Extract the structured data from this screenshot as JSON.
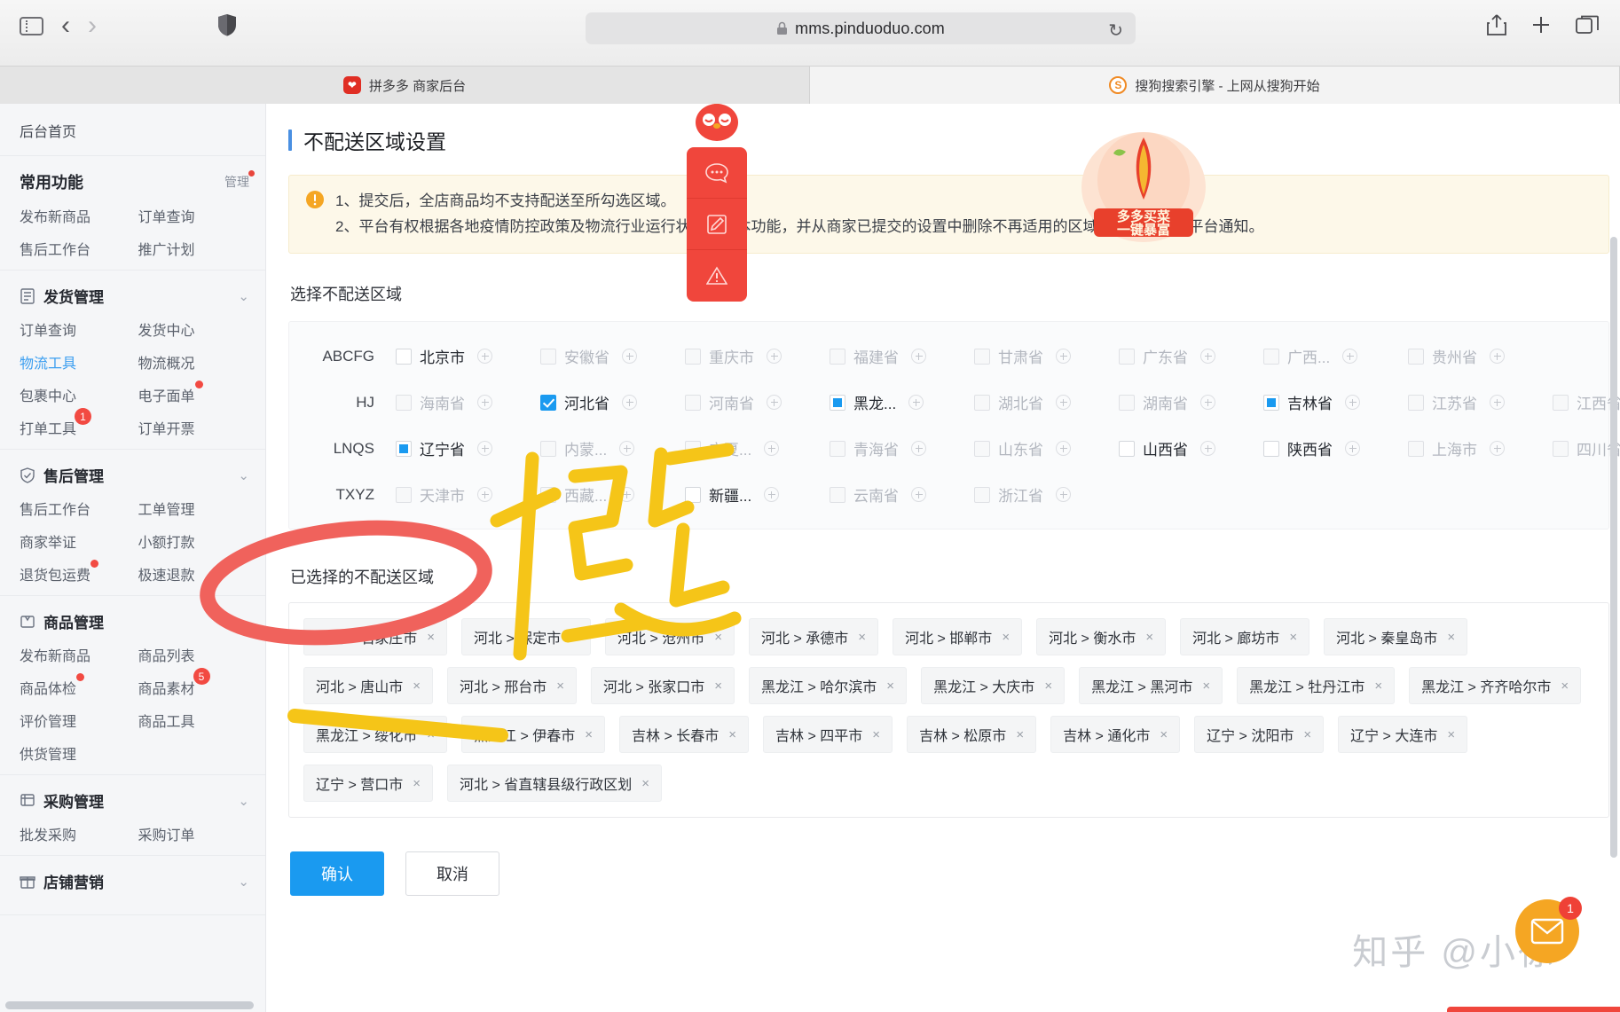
{
  "browser": {
    "url": "mms.pinduoduo.com",
    "lock_icon": "lock-icon",
    "reload_icon": "reload-icon",
    "sidebar_toggle_icon": "sidebar-toggle-icon",
    "back_icon": "back-arrow-icon",
    "forward_icon": "forward-arrow-icon",
    "shield_icon": "privacy-shield-icon",
    "share_icon": "share-icon",
    "newtab_icon": "new-tab-icon",
    "tabs_overview_icon": "tab-overview-icon",
    "tabs": [
      {
        "title": "拼多多 商家后台",
        "favicon": "pinduoduo-favicon",
        "active": false
      },
      {
        "title": "搜狗搜索引擎 - 上网从搜狗开始",
        "favicon": "sogou-favicon",
        "active": true
      }
    ]
  },
  "sidebar": {
    "home": "后台首页",
    "sections": [
      {
        "title": "常用功能",
        "manage_label": "管理",
        "manage_dot": true,
        "icon": null,
        "collapsible": false,
        "links": [
          {
            "label": "发布新商品"
          },
          {
            "label": "订单查询"
          },
          {
            "label": "售后工作台"
          },
          {
            "label": "推广计划"
          }
        ]
      },
      {
        "title": "发货管理",
        "icon": "document-icon",
        "collapsible": true,
        "links": [
          {
            "label": "订单查询"
          },
          {
            "label": "发货中心"
          },
          {
            "label": "物流工具",
            "active": true
          },
          {
            "label": "物流概况"
          },
          {
            "label": "包裹中心"
          },
          {
            "label": "电子面单",
            "badge_dot": true
          },
          {
            "label": "打单工具",
            "badge": "1"
          },
          {
            "label": "订单开票"
          }
        ]
      },
      {
        "title": "售后管理",
        "icon": "shield-check-icon",
        "collapsible": true,
        "links": [
          {
            "label": "售后工作台"
          },
          {
            "label": "工单管理"
          },
          {
            "label": "商家举证"
          },
          {
            "label": "小额打款"
          },
          {
            "label": "退货包运费",
            "badge_dot": true
          },
          {
            "label": "极速退款"
          }
        ]
      },
      {
        "title": "商品管理",
        "icon": "tag-icon",
        "collapsible": true,
        "links": [
          {
            "label": "发布新商品"
          },
          {
            "label": "商品列表"
          },
          {
            "label": "商品体检",
            "badge_dot": true
          },
          {
            "label": "商品素材",
            "badge": "5"
          },
          {
            "label": "评价管理"
          },
          {
            "label": "商品工具"
          },
          {
            "label": "供货管理"
          }
        ]
      },
      {
        "title": "采购管理",
        "icon": "cart-icon",
        "collapsible": true,
        "links": [
          {
            "label": "批发采购"
          },
          {
            "label": "采购订单"
          }
        ]
      },
      {
        "title": "店铺营销",
        "icon": "gift-icon",
        "collapsible": true,
        "links": []
      }
    ]
  },
  "main": {
    "page_title": "不配送区域设置",
    "notice": {
      "icon": "warning-icon",
      "line1": "1、提交后，全店商品均不支持配送至所勾选区域。",
      "line2": "2、平台有权根据各地疫情防控政策及物流行业运行状况更新本功能，并从商家已提交的设置中删除不再适用的区域，请商家关注平台通知。"
    },
    "select_label": "选择不配送区域",
    "province_rows": [
      {
        "group": "ABCFG",
        "items": [
          {
            "name": "北京市",
            "state": "unchecked",
            "highlight": true
          },
          {
            "name": "安徽省",
            "state": "unchecked"
          },
          {
            "name": "重庆市",
            "state": "unchecked"
          },
          {
            "name": "福建省",
            "state": "unchecked"
          },
          {
            "name": "甘肃省",
            "state": "unchecked"
          },
          {
            "name": "广东省",
            "state": "unchecked"
          },
          {
            "name": "广西...",
            "state": "unchecked"
          },
          {
            "name": "贵州省",
            "state": "unchecked"
          }
        ]
      },
      {
        "group": "HJ",
        "items": [
          {
            "name": "海南省",
            "state": "unchecked"
          },
          {
            "name": "河北省",
            "state": "checked",
            "highlight": true
          },
          {
            "name": "河南省",
            "state": "unchecked"
          },
          {
            "name": "黑龙...",
            "state": "indeterminate",
            "highlight": true
          },
          {
            "name": "湖北省",
            "state": "unchecked"
          },
          {
            "name": "湖南省",
            "state": "unchecked"
          },
          {
            "name": "吉林省",
            "state": "indeterminate",
            "highlight": true
          },
          {
            "name": "江苏省",
            "state": "unchecked"
          },
          {
            "name": "江西省",
            "state": "unchecked"
          }
        ]
      },
      {
        "group": "LNQS",
        "items": [
          {
            "name": "辽宁省",
            "state": "indeterminate",
            "highlight": true
          },
          {
            "name": "内蒙...",
            "state": "unchecked"
          },
          {
            "name": "宁夏...",
            "state": "unchecked"
          },
          {
            "name": "青海省",
            "state": "unchecked"
          },
          {
            "name": "山东省",
            "state": "unchecked"
          },
          {
            "name": "山西省",
            "state": "unchecked",
            "highlight": true
          },
          {
            "name": "陕西省",
            "state": "unchecked",
            "highlight": true
          },
          {
            "name": "上海市",
            "state": "unchecked"
          },
          {
            "name": "四川省",
            "state": "unchecked"
          }
        ]
      },
      {
        "group": "TXYZ",
        "items": [
          {
            "name": "天津市",
            "state": "unchecked"
          },
          {
            "name": "西藏...",
            "state": "unchecked"
          },
          {
            "name": "新疆...",
            "state": "unchecked",
            "highlight": true
          },
          {
            "name": "云南省",
            "state": "unchecked"
          },
          {
            "name": "浙江省",
            "state": "unchecked"
          }
        ]
      }
    ],
    "selected_label": "已选择的不配送区域",
    "selected_tags": [
      "河北 > 石家庄市",
      "河北 > 保定市",
      "河北 > 沧州市",
      "河北 > 承德市",
      "河北 > 邯郸市",
      "河北 > 衡水市",
      "河北 > 廊坊市",
      "河北 > 秦皇岛市",
      "河北 > 唐山市",
      "河北 > 邢台市",
      "河北 > 张家口市",
      "黑龙江 > 哈尔滨市",
      "黑龙江 > 大庆市",
      "黑龙江 > 黑河市",
      "黑龙江 > 牡丹江市",
      "黑龙江 > 齐齐哈尔市",
      "黑龙江 > 绥化市",
      "黑龙江 > 伊春市",
      "吉林 > 长春市",
      "吉林 > 四平市",
      "吉林 > 松原市",
      "吉林 > 通化市",
      "辽宁 > 沈阳市",
      "辽宁 > 大连市",
      "辽宁 > 营口市",
      "河北 > 省直辖县级行政区划"
    ],
    "tag_remove_icon": "×",
    "confirm_label": "确认",
    "cancel_label": "取消"
  },
  "widgets": {
    "pdd_assistant": {
      "mascot": "pdd-mascot-icon",
      "buttons": [
        "chat-bubble-icon",
        "edit-note-icon",
        "alert-triangle-icon"
      ]
    },
    "promo_banner": {
      "line1": "多多买菜",
      "line2": "一键暴富",
      "icon": "carrot-icon"
    },
    "chat_fab": {
      "icon": "envelope-icon",
      "badge": "1"
    },
    "watermark": "知乎 @小徐"
  },
  "colors": {
    "accent_blue": "#1a9af0",
    "pdd_red": "#f0463c",
    "notice_bg": "#fdf8e9",
    "annotation_red": "#f0625c",
    "annotation_yellow": "#f5c518",
    "badge_red": "#f24a42"
  }
}
